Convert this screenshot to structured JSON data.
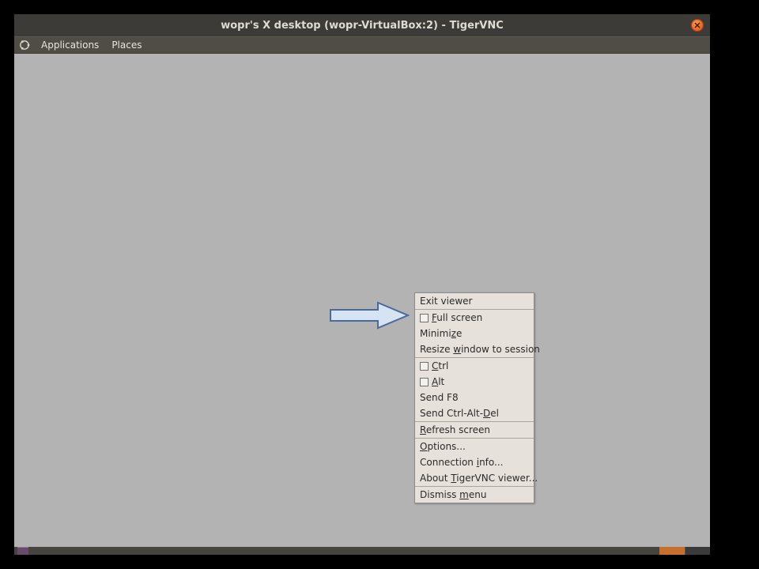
{
  "titlebar": {
    "title": "wopr's X desktop (wopr-VirtualBox:2) - TigerVNC"
  },
  "menubar": {
    "applications": "Applications",
    "places": "Places"
  },
  "context_menu": {
    "exit_viewer": "Exit viewer",
    "full_screen_prefix": "",
    "full_screen_u": "F",
    "full_screen_rest": "ull screen",
    "minimize_prefix": "Minimi",
    "minimize_u": "z",
    "minimize_rest": "e",
    "resize_prefix": "Resize ",
    "resize_u": "w",
    "resize_rest": "indow to session",
    "ctrl_u": "C",
    "ctrl_rest": "trl",
    "alt_u": "A",
    "alt_rest": "lt",
    "send_f8": "Send F8",
    "send_cad_prefix": "Send Ctrl-Alt-",
    "send_cad_u": "D",
    "send_cad_rest": "el",
    "refresh_u": "R",
    "refresh_rest": "efresh screen",
    "options_u": "O",
    "options_rest": "ptions...",
    "conn_info_prefix": "Connection ",
    "conn_info_u": "i",
    "conn_info_rest": "nfo...",
    "about_prefix": "About ",
    "about_u": "T",
    "about_rest": "igerVNC viewer...",
    "dismiss_prefix": "Dismiss ",
    "dismiss_u": "m",
    "dismiss_rest": "enu"
  }
}
